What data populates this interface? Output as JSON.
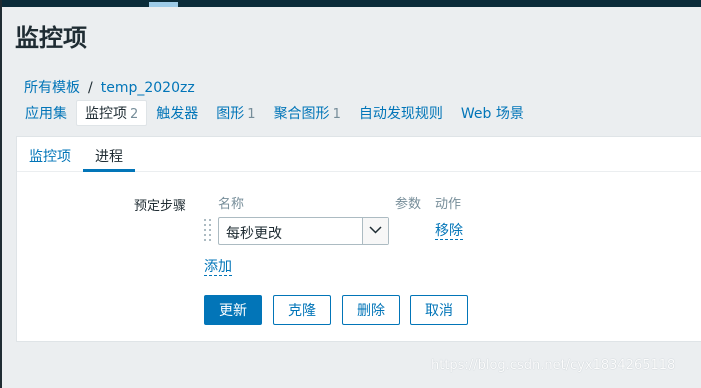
{
  "page": {
    "title": "监控项"
  },
  "breadcrumb": {
    "root": "所有模板",
    "separator": "/",
    "current": "temp_2020zz"
  },
  "sub_tabs": [
    {
      "label": "应用集",
      "count": ""
    },
    {
      "label": "监控项",
      "count": "2"
    },
    {
      "label": "触发器",
      "count": ""
    },
    {
      "label": "图形",
      "count": "1"
    },
    {
      "label": "聚合图形",
      "count": "1"
    },
    {
      "label": "自动发现规则",
      "count": ""
    },
    {
      "label": "Web 场景",
      "count": ""
    }
  ],
  "form_tabs": [
    {
      "label": "监控项",
      "active": false
    },
    {
      "label": "进程",
      "active": true
    }
  ],
  "preprocessing": {
    "label": "预定步骤",
    "columns": {
      "name": "名称",
      "params": "参数",
      "action": "动作"
    },
    "step": {
      "selected": "每秒更改"
    },
    "remove_label": "移除",
    "add_label": "添加"
  },
  "buttons": {
    "update": "更新",
    "clone": "克隆",
    "delete": "删除",
    "cancel": "取消"
  },
  "watermark": "https://blog.csdn.net/cyx1834265118",
  "colors": {
    "link": "#0275b8",
    "topbar": "#0b2c3a",
    "background": "#ebeef0"
  }
}
